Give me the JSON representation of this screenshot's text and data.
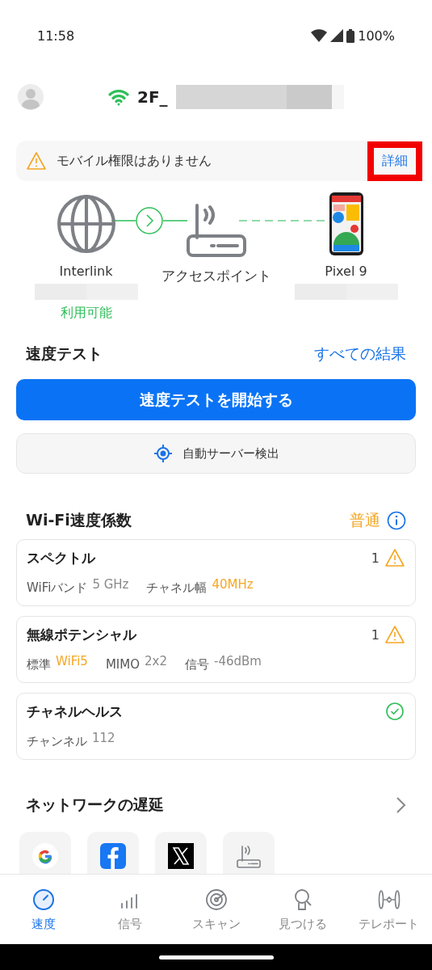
{
  "status_bar": {
    "time": "11:58",
    "battery": "100%"
  },
  "header": {
    "network_name": "2F_"
  },
  "banner": {
    "message": "モバイル権限はありません",
    "link": "詳細",
    "highlighted": true
  },
  "topology": {
    "nodes": [
      {
        "kind": "globe",
        "label": "Interlink",
        "status": "利用可能"
      },
      {
        "kind": "router",
        "label": "アクセスポイント"
      },
      {
        "kind": "phone",
        "label": "Pixel 9"
      }
    ]
  },
  "speed_test": {
    "title": "速度テスト",
    "all_results": "すべての結果",
    "start_button": "速度テストを開始する",
    "server_button": "自動サーバー検出"
  },
  "wifi_score": {
    "title": "Wi-Fi速度係数",
    "rating": "普通",
    "cards": [
      {
        "title": "スペクトル",
        "count": "1",
        "kind": "warning",
        "fields": [
          {
            "label": "WiFiバンド",
            "value": "5 GHz",
            "highlight": false
          },
          {
            "label": "チャネル幅",
            "value": "40MHz",
            "highlight": true
          }
        ]
      },
      {
        "title": "無線ポテンシャル",
        "count": "1",
        "kind": "warning",
        "fields": [
          {
            "label": "標準",
            "value": "WiFi5",
            "highlight": true
          },
          {
            "label": "MIMO",
            "value": "2x2",
            "highlight": false
          },
          {
            "label": "信号",
            "value": "-46dBm",
            "highlight": false
          }
        ]
      },
      {
        "title": "チャネルヘルス",
        "kind": "ok",
        "fields": [
          {
            "label": "チャンネル",
            "value": "112",
            "highlight": false
          }
        ]
      }
    ]
  },
  "latency": {
    "title": "ネットワークの遅延",
    "tiles": [
      {
        "kind": "google"
      },
      {
        "kind": "facebook"
      },
      {
        "kind": "x"
      },
      {
        "kind": "router"
      }
    ]
  },
  "nav": [
    {
      "label": "速度",
      "kind": "gauge",
      "selected": true
    },
    {
      "label": "信号",
      "kind": "bars",
      "selected": false
    },
    {
      "label": "スキャン",
      "kind": "radar",
      "selected": false
    },
    {
      "label": "見つける",
      "kind": "find",
      "selected": false
    },
    {
      "label": "テレポート",
      "kind": "teleport",
      "selected": false
    }
  ]
}
